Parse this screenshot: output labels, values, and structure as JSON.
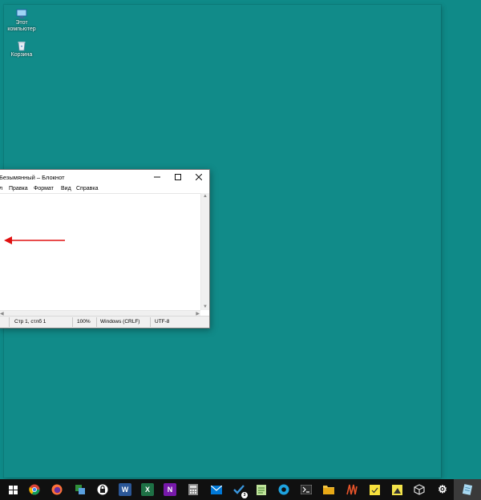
{
  "desktop": {
    "icons": [
      {
        "label": "Этот компьютер",
        "icon": "computer-icon"
      },
      {
        "label": "Корзина",
        "icon": "recycle-bin-icon"
      }
    ]
  },
  "notepad": {
    "title": "Безымянный – Блокнот",
    "menu": [
      "л",
      "Правка",
      "Формат",
      "Вид",
      "Справка"
    ],
    "status": {
      "position": "Стр 1, стлб 1",
      "zoom": "100%",
      "line_endings": "Windows (CRLF)",
      "encoding": "UTF-8"
    }
  },
  "taskbar": {
    "icons": [
      "windows-start-icon",
      "chrome-icon",
      "firefox-icon",
      "app-icon",
      "vpn-lock-icon",
      "word-icon",
      "excel-icon",
      "onenote-icon",
      "calculator-icon",
      "mail-icon",
      "todo-icon",
      "notepadpp-icon",
      "edge-icon",
      "terminal-icon",
      "file-explorer-icon",
      "winamp-icon",
      "sticky-notes-icon",
      "image-editor-icon",
      "virtualbox-icon",
      "settings-icon",
      "notepad-icon"
    ],
    "todo_badge": "3",
    "colors": {
      "background": "#101010",
      "active": "#3a3a3a"
    }
  },
  "colors": {
    "desktop": "#0f8a88",
    "annotation_arrow": "#e01010"
  }
}
